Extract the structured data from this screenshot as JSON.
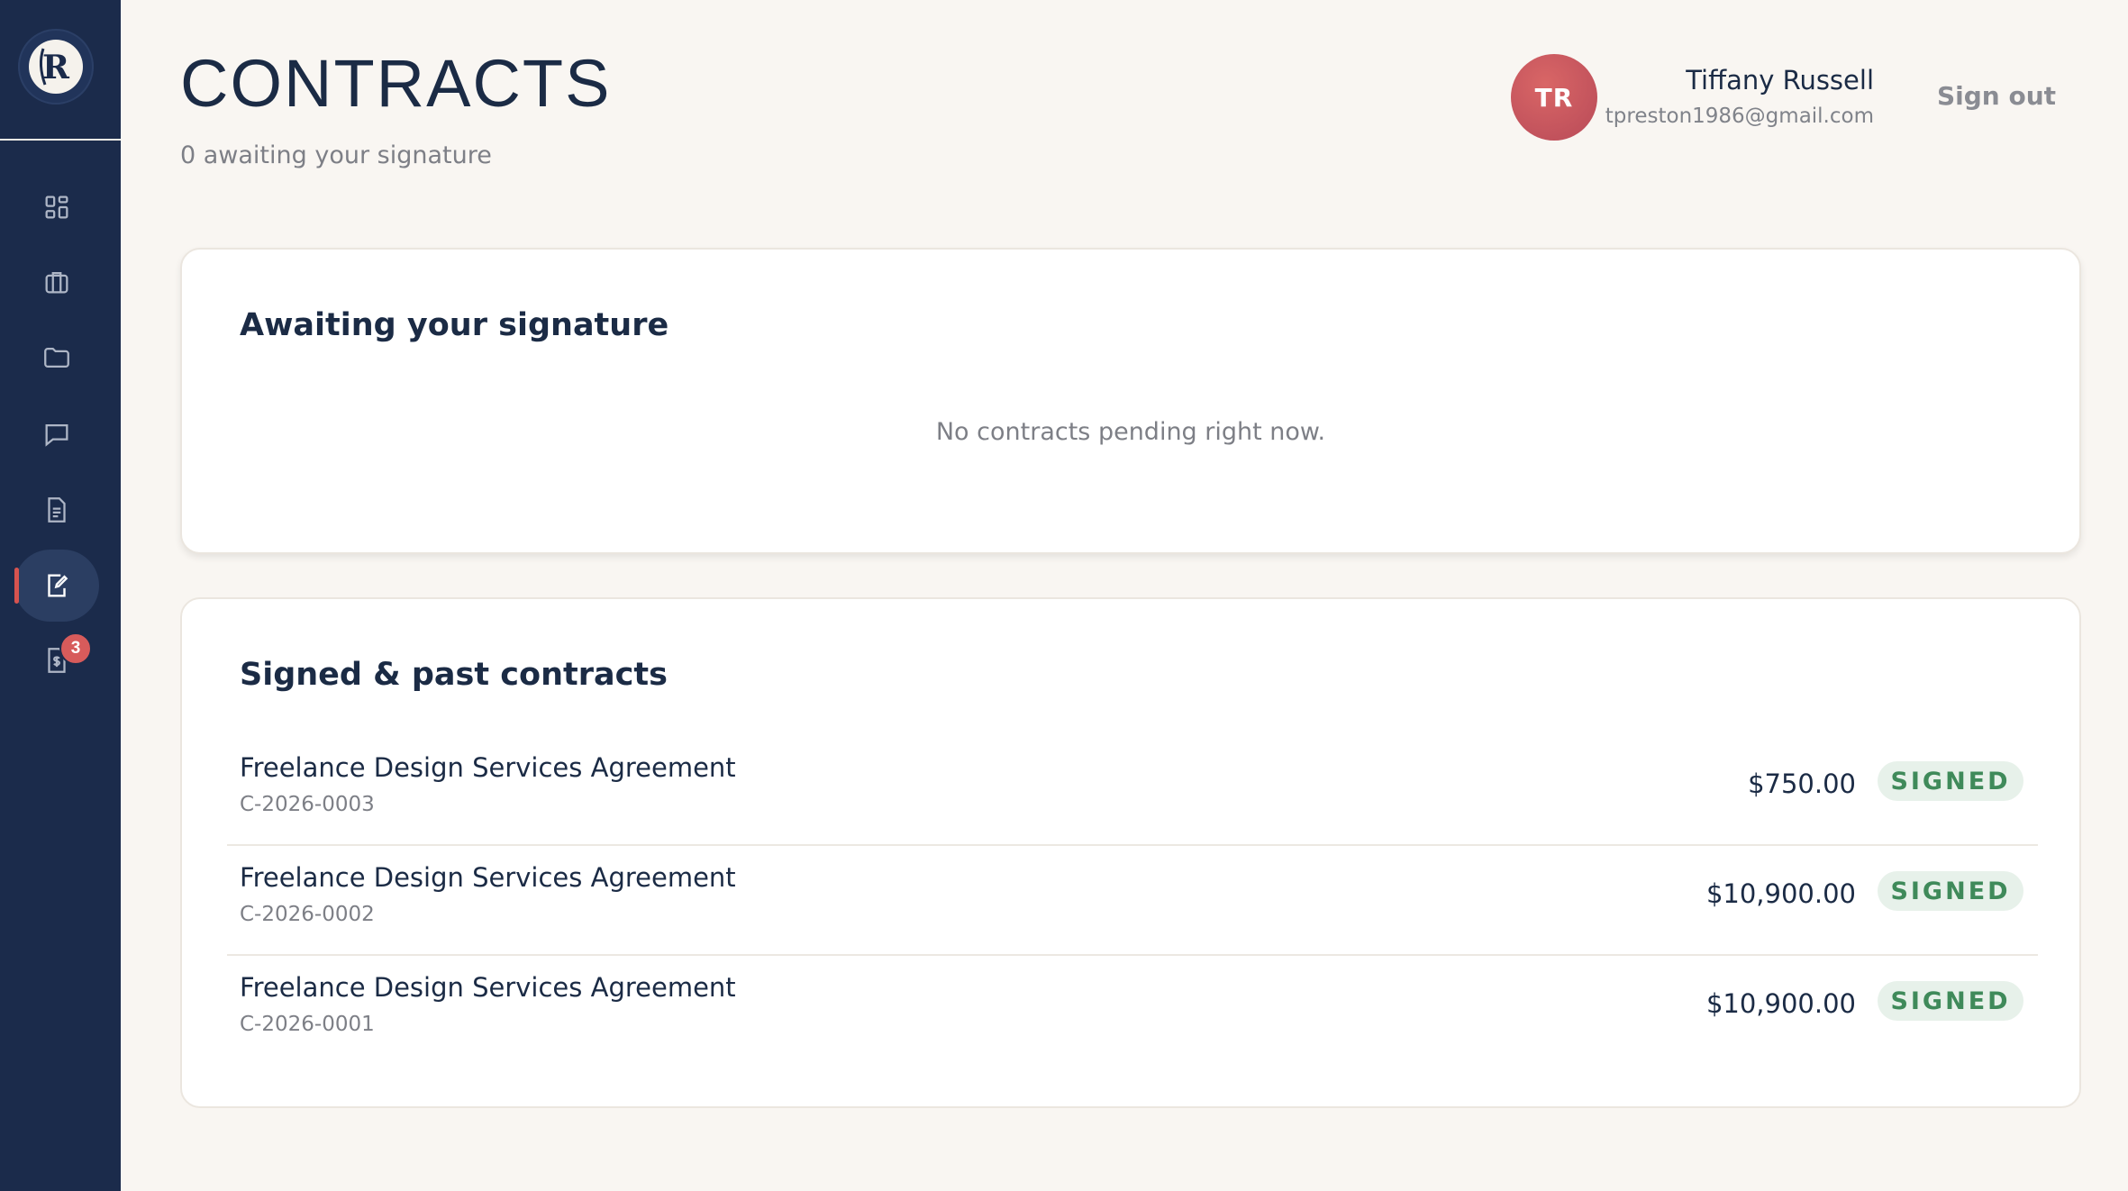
{
  "page": {
    "title": "CONTRACTS",
    "subtitle": "0 awaiting your signature"
  },
  "user": {
    "initials": "TR",
    "name": "Tiffany Russell",
    "email": "tpreston1986@gmail.com",
    "sign_out_label": "Sign out"
  },
  "sidebar": {
    "logo_letter": "R",
    "items": [
      {
        "icon": "dashboard-icon",
        "active": false
      },
      {
        "icon": "briefcase-icon",
        "active": false
      },
      {
        "icon": "folder-icon",
        "active": false
      },
      {
        "icon": "message-icon",
        "active": false
      },
      {
        "icon": "document-icon",
        "active": false
      },
      {
        "icon": "contract-sign-icon",
        "active": true
      },
      {
        "icon": "invoice-icon",
        "active": false,
        "badge": "3"
      }
    ]
  },
  "awaiting": {
    "title": "Awaiting your signature",
    "empty_message": "No contracts pending right now."
  },
  "signed": {
    "title": "Signed & past contracts",
    "rows": [
      {
        "name": "Freelance Design Services Agreement",
        "id": "C-2026-0003",
        "amount": "$750.00",
        "status": "SIGNED"
      },
      {
        "name": "Freelance Design Services Agreement",
        "id": "C-2026-0002",
        "amount": "$10,900.00",
        "status": "SIGNED"
      },
      {
        "name": "Freelance Design Services Agreement",
        "id": "C-2026-0001",
        "amount": "$10,900.00",
        "status": "SIGNED"
      }
    ]
  },
  "colors": {
    "sidebar": "#1b2b4b",
    "accent": "#d6534f",
    "signed_text": "#3f8a5a",
    "signed_bg": "#e7f1ea",
    "background": "#f9f6f2"
  }
}
